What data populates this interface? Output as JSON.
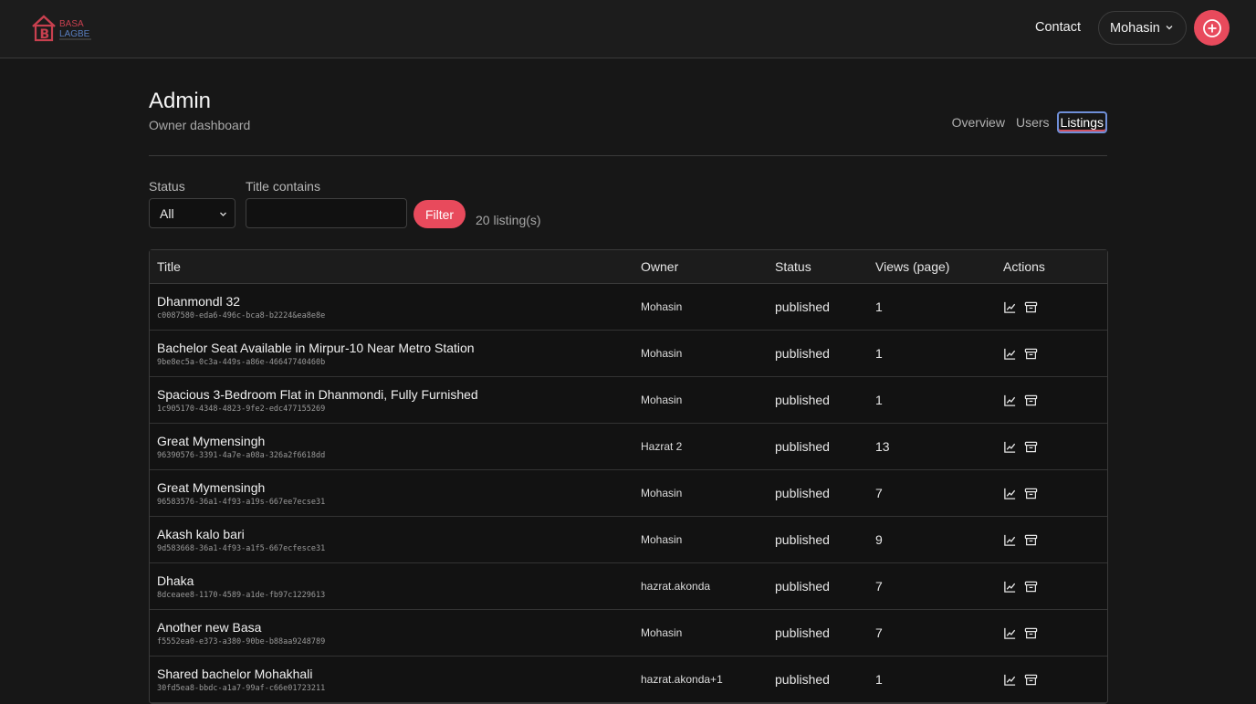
{
  "header": {
    "logo_text_top": "BASA",
    "logo_text_bottom": "LAGBE",
    "contact_label": "Contact",
    "user_name": "Mohasin",
    "brand_color": "#e84a5c"
  },
  "page": {
    "title": "Admin",
    "subtitle": "Owner dashboard",
    "tabs": [
      {
        "label": "Overview",
        "active": false
      },
      {
        "label": "Users",
        "active": false
      },
      {
        "label": "Listings",
        "active": true
      }
    ]
  },
  "filters": {
    "status_label": "Status",
    "status_value": "All",
    "title_label": "Title contains",
    "title_value": "",
    "filter_button": "Filter",
    "count_text": "20 listing(s)"
  },
  "table": {
    "columns": [
      "Title",
      "Owner",
      "Status",
      "Views (page)",
      "Actions"
    ],
    "rows": [
      {
        "title": "Dhanmondl 32",
        "id": "c0087580-eda6-496c-bca8-b2224&ea8e8e",
        "owner": "Mohasin",
        "status": "published",
        "views": "1"
      },
      {
        "title": "Bachelor Seat Available in Mirpur-10 Near Metro Station",
        "id": "9be8ec5a-0c3a-449s-a86e-46647740460b",
        "owner": "Mohasin",
        "status": "published",
        "views": "1"
      },
      {
        "title": "Spacious 3-Bedroom Flat in Dhanmondi, Fully Furnished",
        "id": "1c905170-4348-4823-9fe2-edc477155269",
        "owner": "Mohasin",
        "status": "published",
        "views": "1"
      },
      {
        "title": "Great Mymensingh",
        "id": "96390576-3391-4a7e-a08a-326a2f6618dd",
        "owner": "Hazrat 2",
        "status": "published",
        "views": "13"
      },
      {
        "title": "Great Mymensingh",
        "id": "96583576-36a1-4f93-a19s-667ee7ecse31",
        "owner": "Mohasin",
        "status": "published",
        "views": "7"
      },
      {
        "title": "Akash kalo bari",
        "id": "9d583668-36a1-4f93-a1f5-667ecfesce31",
        "owner": "Mohasin",
        "status": "published",
        "views": "9"
      },
      {
        "title": "Dhaka",
        "id": "8dceaee8-1170-4589-a1de-fb97c1229613",
        "owner": "hazrat.akonda",
        "status": "published",
        "views": "7"
      },
      {
        "title": "Another new Basa",
        "id": "f5552ea0-e373-a380-90be-b88aa9248789",
        "owner": "Mohasin",
        "status": "published",
        "views": "7"
      },
      {
        "title": "Shared bachelor Mohakhali",
        "id": "30fd5ea8-bbdc-a1a7-99af-c66e01723211",
        "owner": "hazrat.akonda+1",
        "status": "published",
        "views": "1"
      }
    ],
    "action_icons": [
      "chart-line-icon",
      "archive-icon"
    ]
  }
}
